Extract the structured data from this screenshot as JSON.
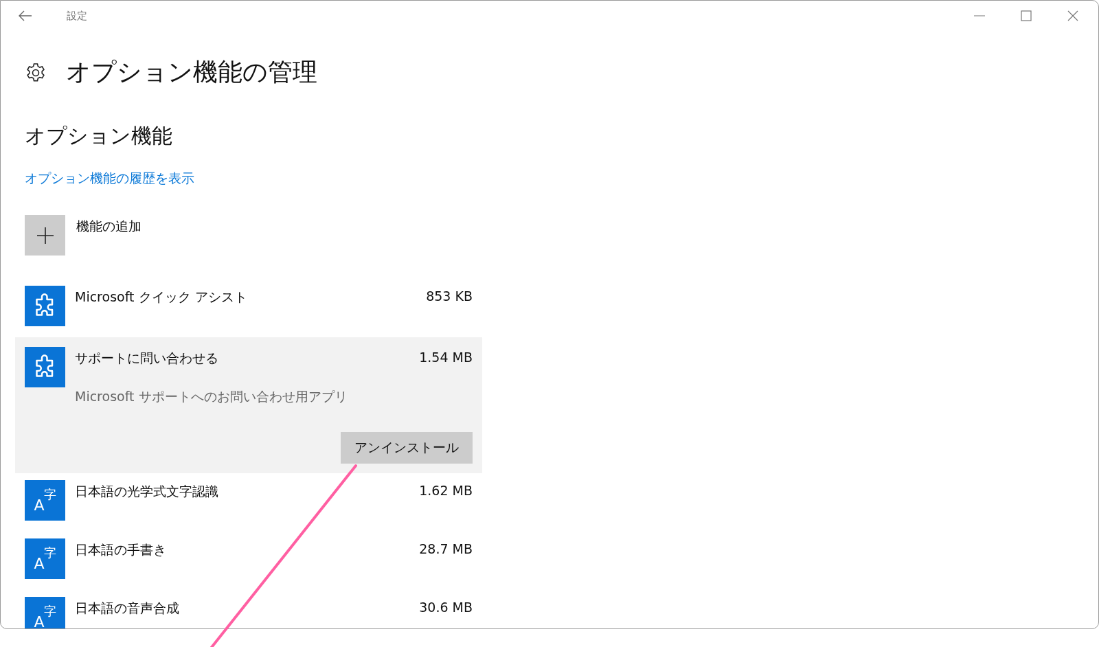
{
  "window": {
    "title": "設定"
  },
  "page_title": "オプション機能の管理",
  "section_title": "オプション機能",
  "history_link": "オプション機能の履歴を表示",
  "add_feature": {
    "label": "機能の追加"
  },
  "features": [
    {
      "kind": "puzzle",
      "name": "Microsoft クイック アシスト",
      "size": "853 KB",
      "expanded": false
    },
    {
      "kind": "puzzle",
      "name": "サポートに問い合わせる",
      "size": "1.54 MB",
      "expanded": true,
      "description": "Microsoft サポートへのお問い合わせ用アプリ",
      "button": "アンインストール"
    },
    {
      "kind": "language",
      "icon_main": "A",
      "icon_sup": "字",
      "name": "日本語の光学式文字認識",
      "size": "1.62 MB",
      "expanded": false
    },
    {
      "kind": "language",
      "icon_main": "A",
      "icon_sup": "字",
      "name": "日本語の手書き",
      "size": "28.7 MB",
      "expanded": false
    },
    {
      "kind": "language",
      "icon_main": "A",
      "icon_sup": "字",
      "name": "日本語の音声合成",
      "size": "30.6 MB",
      "expanded": false
    }
  ]
}
